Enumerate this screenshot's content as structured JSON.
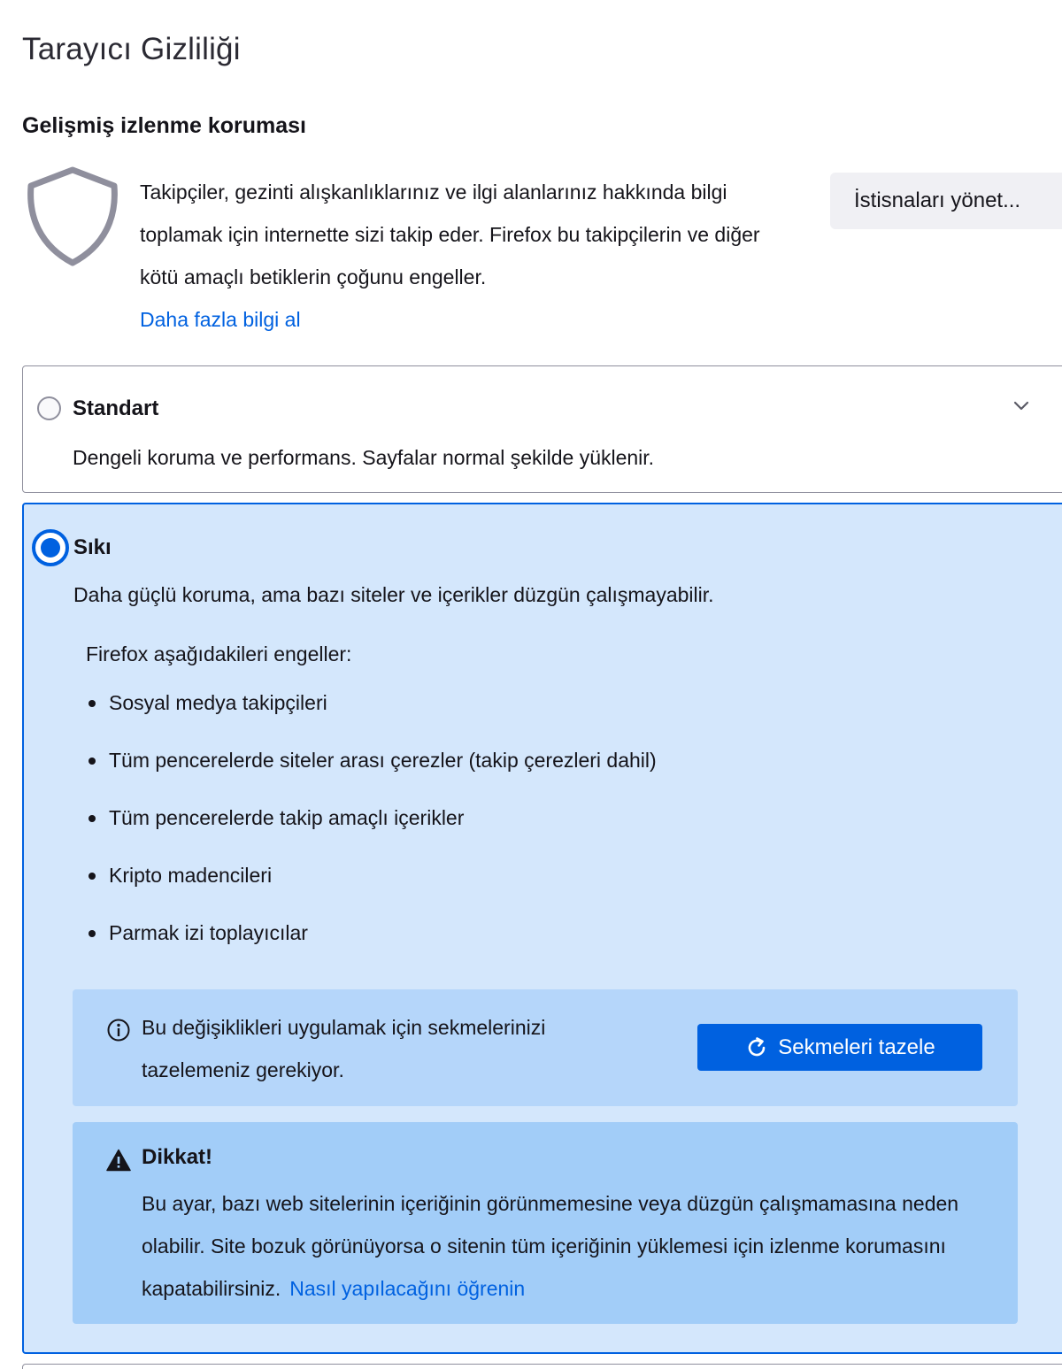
{
  "page": {
    "title": "Tarayıcı Gizliliği"
  },
  "tracking_protection": {
    "heading": "Gelişmiş izlenme koruması",
    "icon": "shield-icon",
    "description": "Takipçiler, gezinti alışkanlıklarınız ve ilgi alanlarınız hakkında bilgi toplamak için internette sizi takip eder. Firefox bu takipçilerin ve diğer kötü amaçlı betiklerin çoğunu engeller.",
    "learn_more_link": "Daha fazla bilgi al",
    "manage_exceptions_button": "İstisnaları yönet..."
  },
  "options": {
    "standard": {
      "label": "Standart",
      "description": "Dengeli koruma ve performans. Sayfalar normal şekilde yüklenir.",
      "selected": false
    },
    "strict": {
      "label": "Sıkı",
      "description": "Daha güçlü koruma, ama bazı siteler ve içerikler düzgün çalışmayabilir.",
      "selected": true,
      "blocks_heading": "Firefox aşağıdakileri engeller:",
      "blocks": [
        "Sosyal medya takipçileri",
        "Tüm pencerelerde siteler arası çerezler (takip çerezleri dahil)",
        "Tüm pencerelerde takip amaçlı içerikler",
        "Kripto madencileri",
        "Parmak izi toplayıcılar"
      ],
      "reload_notice": {
        "text": "Bu değişiklikleri uygulamak için sekmelerinizi tazelemeniz gerekiyor.",
        "button": "Sekmeleri tazele"
      },
      "warning": {
        "title": "Dikkat!",
        "text": "Bu ayar, bazı web sitelerinin içeriğinin görünmemesine veya düzgün çalışmamasına neden olabilir. Site bozuk görünüyorsa o sitenin tüm içeriğinin yüklemesi için izlenme korumasını kapatabilirsiniz.",
        "link": "Nasıl yapılacağını öğrenin"
      }
    }
  },
  "colors": {
    "accent": "#0061e0",
    "selected_card_bg": "#d4e7fc",
    "info_box_bg": "#b5d6fa",
    "warning_box_bg": "#a2cdf8",
    "neutral_button_bg": "#f0f0f4"
  }
}
